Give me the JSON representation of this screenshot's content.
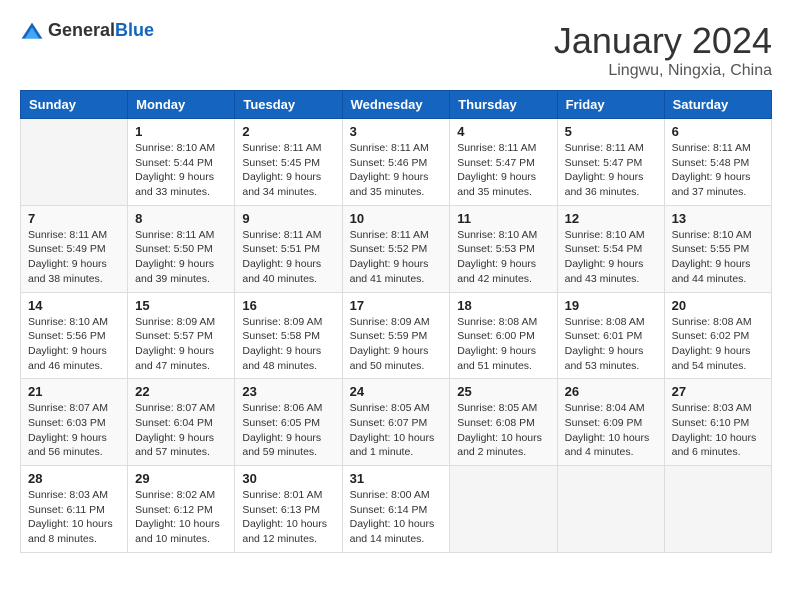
{
  "header": {
    "logo": {
      "text_general": "General",
      "text_blue": "Blue"
    },
    "title": "January 2024",
    "location": "Lingwu, Ningxia, China"
  },
  "calendar": {
    "days_of_week": [
      "Sunday",
      "Monday",
      "Tuesday",
      "Wednesday",
      "Thursday",
      "Friday",
      "Saturday"
    ],
    "weeks": [
      [
        {
          "day": "",
          "info": ""
        },
        {
          "day": "1",
          "info": "Sunrise: 8:10 AM\nSunset: 5:44 PM\nDaylight: 9 hours\nand 33 minutes."
        },
        {
          "day": "2",
          "info": "Sunrise: 8:11 AM\nSunset: 5:45 PM\nDaylight: 9 hours\nand 34 minutes."
        },
        {
          "day": "3",
          "info": "Sunrise: 8:11 AM\nSunset: 5:46 PM\nDaylight: 9 hours\nand 35 minutes."
        },
        {
          "day": "4",
          "info": "Sunrise: 8:11 AM\nSunset: 5:47 PM\nDaylight: 9 hours\nand 35 minutes."
        },
        {
          "day": "5",
          "info": "Sunrise: 8:11 AM\nSunset: 5:47 PM\nDaylight: 9 hours\nand 36 minutes."
        },
        {
          "day": "6",
          "info": "Sunrise: 8:11 AM\nSunset: 5:48 PM\nDaylight: 9 hours\nand 37 minutes."
        }
      ],
      [
        {
          "day": "7",
          "info": "Sunrise: 8:11 AM\nSunset: 5:49 PM\nDaylight: 9 hours\nand 38 minutes."
        },
        {
          "day": "8",
          "info": "Sunrise: 8:11 AM\nSunset: 5:50 PM\nDaylight: 9 hours\nand 39 minutes."
        },
        {
          "day": "9",
          "info": "Sunrise: 8:11 AM\nSunset: 5:51 PM\nDaylight: 9 hours\nand 40 minutes."
        },
        {
          "day": "10",
          "info": "Sunrise: 8:11 AM\nSunset: 5:52 PM\nDaylight: 9 hours\nand 41 minutes."
        },
        {
          "day": "11",
          "info": "Sunrise: 8:10 AM\nSunset: 5:53 PM\nDaylight: 9 hours\nand 42 minutes."
        },
        {
          "day": "12",
          "info": "Sunrise: 8:10 AM\nSunset: 5:54 PM\nDaylight: 9 hours\nand 43 minutes."
        },
        {
          "day": "13",
          "info": "Sunrise: 8:10 AM\nSunset: 5:55 PM\nDaylight: 9 hours\nand 44 minutes."
        }
      ],
      [
        {
          "day": "14",
          "info": "Sunrise: 8:10 AM\nSunset: 5:56 PM\nDaylight: 9 hours\nand 46 minutes."
        },
        {
          "day": "15",
          "info": "Sunrise: 8:09 AM\nSunset: 5:57 PM\nDaylight: 9 hours\nand 47 minutes."
        },
        {
          "day": "16",
          "info": "Sunrise: 8:09 AM\nSunset: 5:58 PM\nDaylight: 9 hours\nand 48 minutes."
        },
        {
          "day": "17",
          "info": "Sunrise: 8:09 AM\nSunset: 5:59 PM\nDaylight: 9 hours\nand 50 minutes."
        },
        {
          "day": "18",
          "info": "Sunrise: 8:08 AM\nSunset: 6:00 PM\nDaylight: 9 hours\nand 51 minutes."
        },
        {
          "day": "19",
          "info": "Sunrise: 8:08 AM\nSunset: 6:01 PM\nDaylight: 9 hours\nand 53 minutes."
        },
        {
          "day": "20",
          "info": "Sunrise: 8:08 AM\nSunset: 6:02 PM\nDaylight: 9 hours\nand 54 minutes."
        }
      ],
      [
        {
          "day": "21",
          "info": "Sunrise: 8:07 AM\nSunset: 6:03 PM\nDaylight: 9 hours\nand 56 minutes."
        },
        {
          "day": "22",
          "info": "Sunrise: 8:07 AM\nSunset: 6:04 PM\nDaylight: 9 hours\nand 57 minutes."
        },
        {
          "day": "23",
          "info": "Sunrise: 8:06 AM\nSunset: 6:05 PM\nDaylight: 9 hours\nand 59 minutes."
        },
        {
          "day": "24",
          "info": "Sunrise: 8:05 AM\nSunset: 6:07 PM\nDaylight: 10 hours\nand 1 minute."
        },
        {
          "day": "25",
          "info": "Sunrise: 8:05 AM\nSunset: 6:08 PM\nDaylight: 10 hours\nand 2 minutes."
        },
        {
          "day": "26",
          "info": "Sunrise: 8:04 AM\nSunset: 6:09 PM\nDaylight: 10 hours\nand 4 minutes."
        },
        {
          "day": "27",
          "info": "Sunrise: 8:03 AM\nSunset: 6:10 PM\nDaylight: 10 hours\nand 6 minutes."
        }
      ],
      [
        {
          "day": "28",
          "info": "Sunrise: 8:03 AM\nSunset: 6:11 PM\nDaylight: 10 hours\nand 8 minutes."
        },
        {
          "day": "29",
          "info": "Sunrise: 8:02 AM\nSunset: 6:12 PM\nDaylight: 10 hours\nand 10 minutes."
        },
        {
          "day": "30",
          "info": "Sunrise: 8:01 AM\nSunset: 6:13 PM\nDaylight: 10 hours\nand 12 minutes."
        },
        {
          "day": "31",
          "info": "Sunrise: 8:00 AM\nSunset: 6:14 PM\nDaylight: 10 hours\nand 14 minutes."
        },
        {
          "day": "",
          "info": ""
        },
        {
          "day": "",
          "info": ""
        },
        {
          "day": "",
          "info": ""
        }
      ]
    ]
  }
}
